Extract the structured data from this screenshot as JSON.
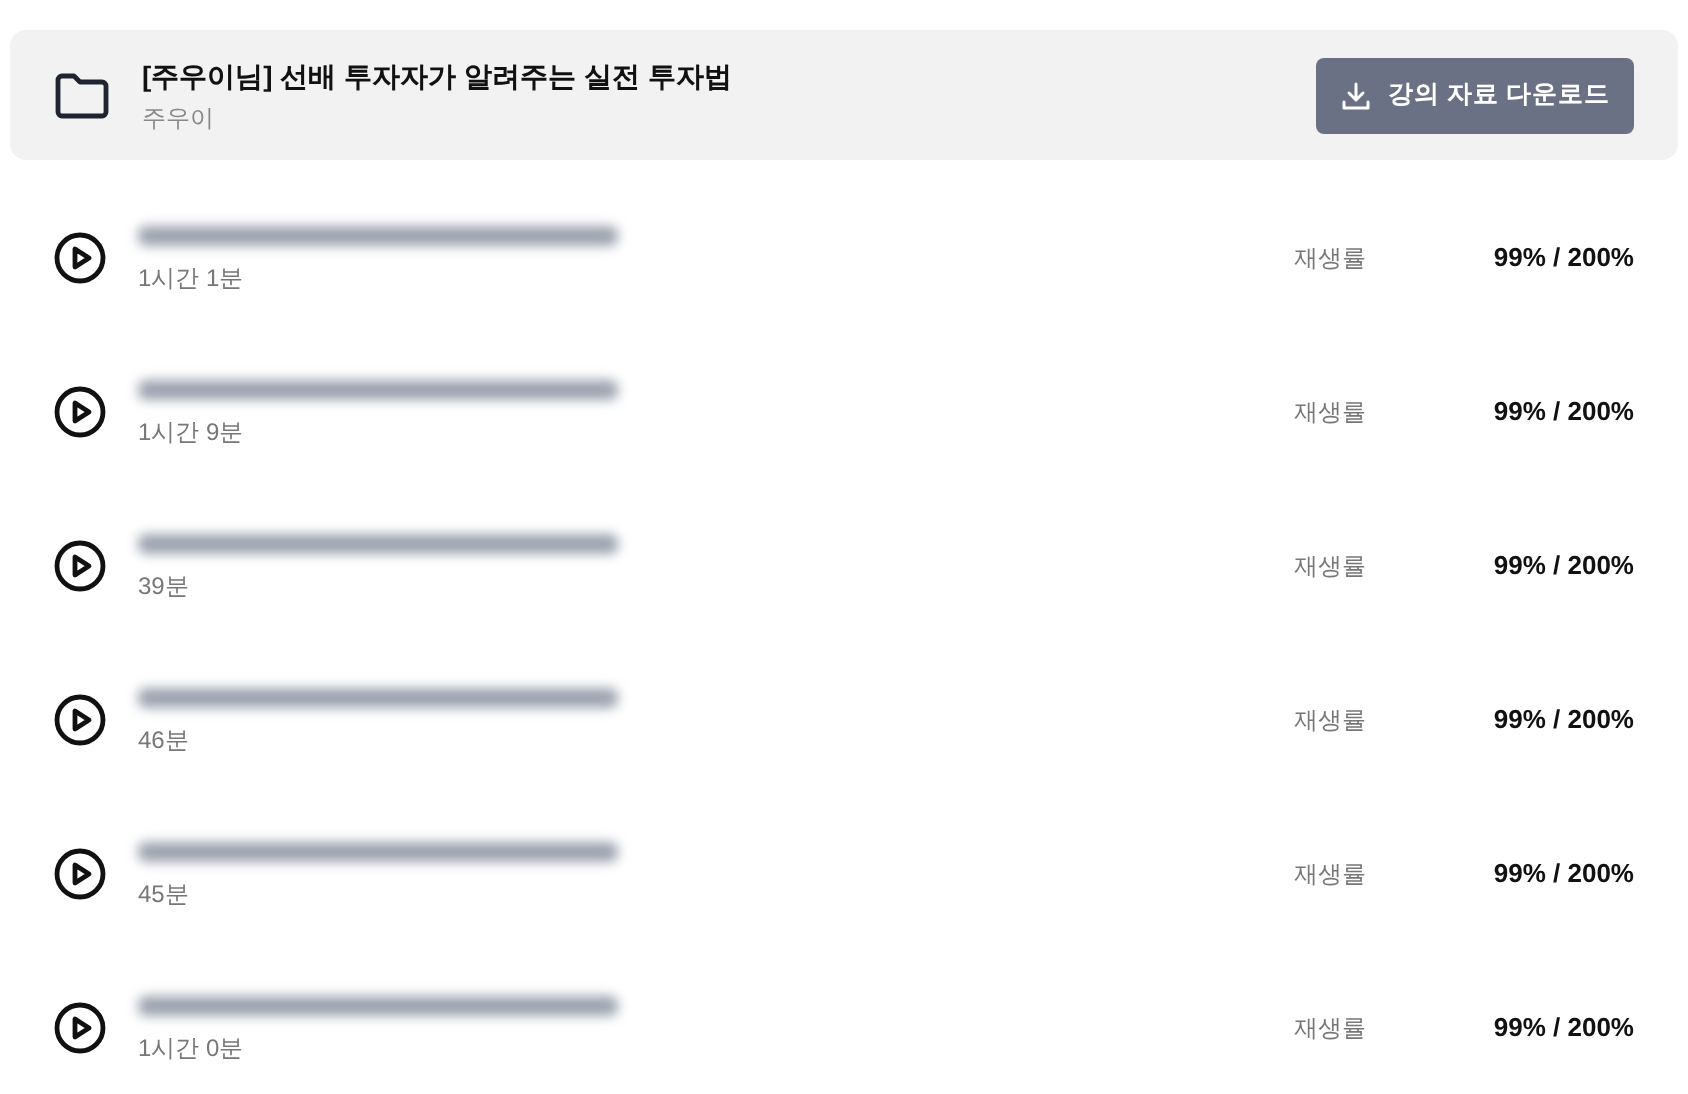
{
  "course": {
    "title": "[주우이님] 선배 투자자가 알려주는 실전 투자법",
    "instructor": "주우이",
    "download_button": "강의 자료 다운로드"
  },
  "lectures": [
    {
      "kind": "blurred",
      "duration": "1시간 1분",
      "rate_label": "재생률",
      "rate": "99% / 200%"
    },
    {
      "kind": "blurred",
      "duration": "1시간 9분",
      "rate_label": "재생률",
      "rate": "99% / 200%"
    },
    {
      "kind": "blurred",
      "duration": "39분",
      "rate_label": "재생률",
      "rate": "99% / 200%"
    },
    {
      "kind": "blurred",
      "duration": "46분",
      "rate_label": "재생률",
      "rate": "99% / 200%"
    },
    {
      "kind": "blurred",
      "duration": "45분",
      "rate_label": "재생률",
      "rate": "99% / 200%"
    },
    {
      "kind": "blurred",
      "duration": "1시간 0분",
      "rate_label": "재생률",
      "rate": "99% / 200%"
    }
  ]
}
